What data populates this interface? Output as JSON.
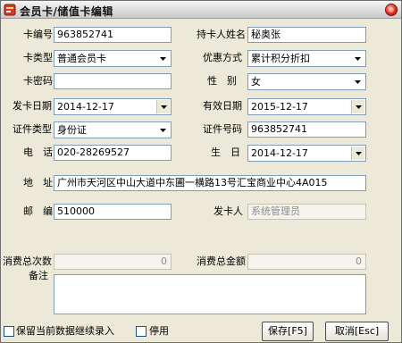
{
  "window": {
    "title": "会员卡/储值卡编辑"
  },
  "form": {
    "card_no": {
      "label": "卡编号",
      "value": "963852741"
    },
    "holder_name": {
      "label": "持卡人姓名",
      "value": "秘奥张"
    },
    "card_type": {
      "label": "卡类型",
      "value": "普通会员卡"
    },
    "discount_mode": {
      "label": "优惠方式",
      "value": "累计积分折扣"
    },
    "card_password": {
      "label": "卡密码",
      "value": ""
    },
    "gender": {
      "label": "性　别",
      "value": "女"
    },
    "issue_date": {
      "label": "发卡日期",
      "value": "2014-12-17"
    },
    "valid_date": {
      "label": "有效日期",
      "value": "2015-12-17"
    },
    "id_type": {
      "label": "证件类型",
      "value": "身份证"
    },
    "id_number": {
      "label": "证件号码",
      "value": "963852741"
    },
    "phone": {
      "label": "电　话",
      "value": "020-28269527"
    },
    "birthday": {
      "label": "生　日",
      "value": "2014-12-17"
    },
    "address": {
      "label": "地　址",
      "value": "广州市天河区中山大道中东圃一横路13号汇宝商业中心4A015"
    },
    "postcode": {
      "label": "邮　编",
      "value": "510000"
    },
    "issuer": {
      "label": "发卡人",
      "value": "系统管理员"
    },
    "total_count": {
      "label": "消费总次数",
      "value": "0"
    },
    "total_amount": {
      "label": "消费总金额",
      "value": "0"
    },
    "remarks": {
      "label": "备注",
      "value": ""
    }
  },
  "options": {
    "keep_data_label": "保留当前数据继续录入",
    "disable_label": "停用"
  },
  "buttons": {
    "save": "保存[F5]",
    "cancel": "取消[Esc]"
  }
}
